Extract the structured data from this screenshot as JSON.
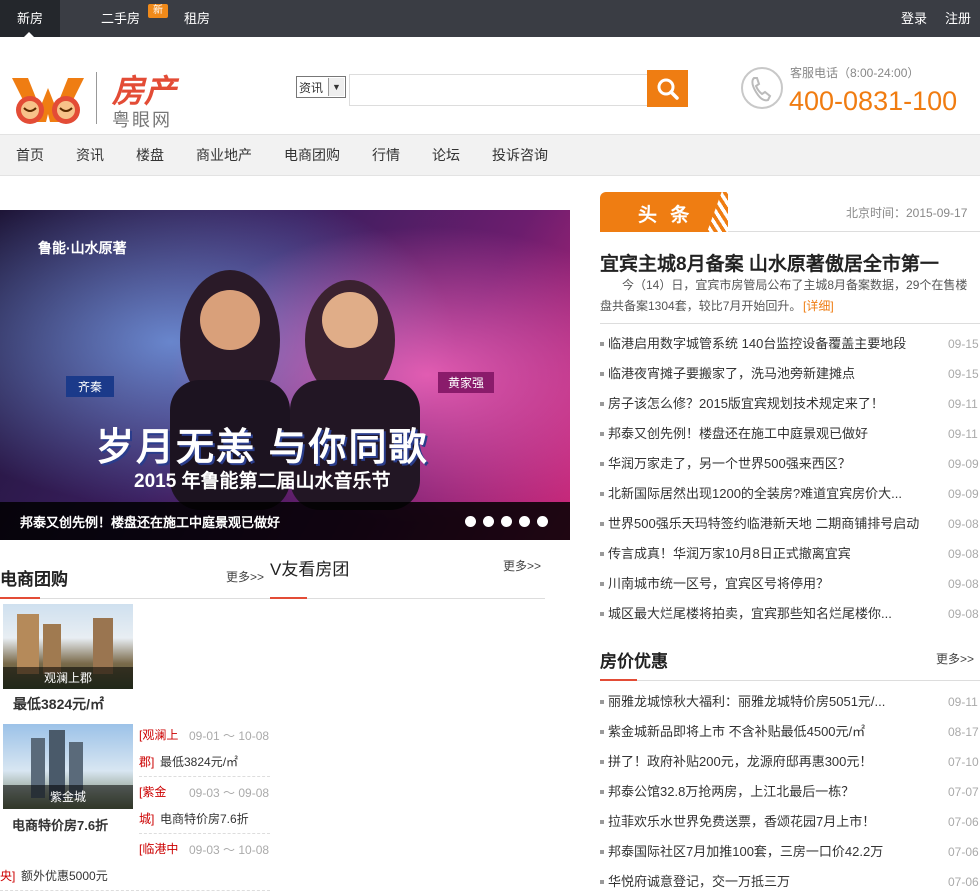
{
  "topbar": {
    "tabs": [
      "新房",
      "二手房",
      "租房"
    ],
    "badge": "新",
    "login": "登录",
    "register": "注册"
  },
  "header": {
    "logo_title": "房产",
    "logo_sub": "粤眼网",
    "search_category": "资讯",
    "search_placeholder": "",
    "service_label": "客服电话（8:00-24:00）",
    "service_number": "400-0831-100"
  },
  "nav": [
    "首页",
    "资讯",
    "楼盘",
    "商业地产",
    "电商团购",
    "行情",
    "论坛",
    "投诉咨询"
  ],
  "banner": {
    "brand": "鲁能·山水原著",
    "name_left": "齐秦",
    "name_right": "黄家强",
    "headline": "岁月无恙 与你同歌",
    "subline": "2015 年鲁能第二届山水音乐节",
    "caption": "邦泰又创先例！楼盘还在施工中庭景观已做好",
    "dot_count": 5
  },
  "ecommerce": {
    "title": "电商团购",
    "more": "更多>>",
    "feature": {
      "tag": "观澜上郡",
      "price": "最低3824元/㎡"
    },
    "feature2": {
      "tag": "紫金城",
      "price": "电商特价房7.6折"
    },
    "items": [
      {
        "name1": "[观澜上",
        "name2": "郡]",
        "date": "09-01 ～ 10-08",
        "desc": "最低3824元/㎡"
      },
      {
        "name1": "[紫金",
        "name2": "城]",
        "date": "09-03 ～ 09-08",
        "desc": "电商特价房7.6折"
      },
      {
        "name1": "[临港中",
        "name2": "央]",
        "date": "09-03 ～ 10-08",
        "desc": "额外优惠5000元"
      }
    ]
  },
  "vyou": {
    "title": "V友看房团",
    "more": "更多>>"
  },
  "headlines": {
    "badge": "头 条",
    "time_label": "北京时间：2015-09-17",
    "top_title": "宜宾主城8月备案 山水原著傲居全市第一",
    "top_summary_1": "今（14）日，宜宾市房管局公布了主城8月备案数据，29个在售楼",
    "top_summary_2": "盘共备案1304套，较比7月开始回升。",
    "detail_link": "[详细]",
    "items": [
      {
        "text": "临港启用数字城管系统 140台监控设备覆盖主要地段",
        "date": "09-15"
      },
      {
        "text": "临港夜宵摊子要搬家了，洗马池旁新建摊点",
        "date": "09-15"
      },
      {
        "text": "房子该怎么修？2015版宜宾规划技术规定来了！",
        "date": "09-11"
      },
      {
        "text": "邦泰又创先例！楼盘还在施工中庭景观已做好",
        "date": "09-11"
      },
      {
        "text": "华润万家走了，另一个世界500强来西区？",
        "date": "09-09"
      },
      {
        "text": "北新国际居然出现1200的全装房?难道宜宾房价大...",
        "date": "09-09"
      },
      {
        "text": "世界500强乐天玛特签约临港新天地 二期商铺排号启动",
        "date": "09-08"
      },
      {
        "text": "传言成真！华润万家10月8日正式撤离宜宾",
        "date": "09-08"
      },
      {
        "text": "川南城市统一区号，宜宾区号将停用？",
        "date": "09-08"
      },
      {
        "text": "城区最大烂尾楼将拍卖，宜宾那些知名烂尾楼你...",
        "date": "09-08"
      }
    ]
  },
  "deals": {
    "title": "房价优惠",
    "more": "更多>>",
    "items": [
      {
        "text": "丽雅龙城惊秋大福利：丽雅龙城特价房5051元/...",
        "date": "09-11"
      },
      {
        "text": "紫金城新品即将上市 不含补贴最低4500元/㎡",
        "date": "08-17"
      },
      {
        "text": "拼了！政府补贴200元，龙源府邸再惠300元！",
        "date": "07-10"
      },
      {
        "text": "邦泰公馆32.8万抢两房，上江北最后一栋？",
        "date": "07-07"
      },
      {
        "text": "拉菲欢乐水世界免费送票，香颂花园7月上市！",
        "date": "07-06"
      },
      {
        "text": "邦泰国际社区7月加推100套，三房一口价42.2万",
        "date": "07-06"
      },
      {
        "text": "华悦府诚意登记，交一万抵三万",
        "date": "07-06"
      }
    ]
  },
  "colors": {
    "accent": "#ef7d12",
    "topbar": "#3a3d44",
    "brand_red": "#e34c36"
  }
}
